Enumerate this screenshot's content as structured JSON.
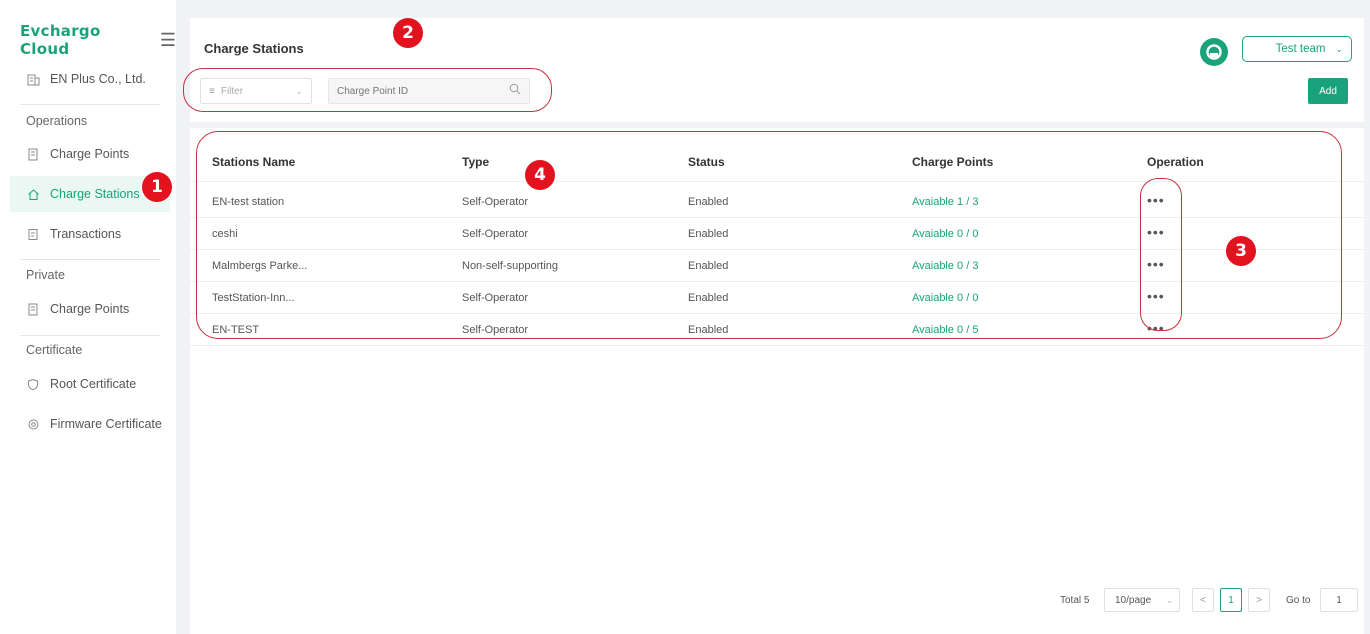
{
  "brand": {
    "name": "Evchargo Cloud"
  },
  "sidebar": {
    "company": "EN Plus Co., Ltd.",
    "sections": [
      {
        "title": "Operations",
        "items": [
          {
            "label": "Charge Points",
            "icon": "charger-icon"
          },
          {
            "label": "Charge Stations",
            "icon": "home-icon",
            "active": true
          },
          {
            "label": "Transactions",
            "icon": "receipt-icon"
          }
        ]
      },
      {
        "title": "Private",
        "items": [
          {
            "label": "Charge Points",
            "icon": "charger-icon"
          }
        ]
      },
      {
        "title": "Certificate",
        "items": [
          {
            "label": "Root Certificate",
            "icon": "shield-icon"
          },
          {
            "label": "Firmware Certificate",
            "icon": "gear-icon"
          }
        ]
      }
    ]
  },
  "header": {
    "title": "Charge Stations",
    "filter_placeholder": "Filter",
    "search_placeholder": "Charge Point ID",
    "team": "Test team",
    "add_label": "Add"
  },
  "table": {
    "columns": [
      "Stations Name",
      "Type",
      "Status",
      "Charge Points",
      "Operation"
    ],
    "rows": [
      {
        "name": "EN-test station",
        "type": "Self-Operator",
        "status": "Enabled",
        "charge_points": "Avaiable  1 / 3",
        "op": "•••"
      },
      {
        "name": "ceshi",
        "type": "Self-Operator",
        "status": "Enabled",
        "charge_points": "Avaiable  0 / 0",
        "op": "•••"
      },
      {
        "name": "Malmbergs Parke...",
        "type": "Non-self-supporting",
        "status": "Enabled",
        "charge_points": "Avaiable  0 / 3",
        "op": "•••"
      },
      {
        "name": "TestStation-Inn...",
        "type": "Self-Operator",
        "status": "Enabled",
        "charge_points": "Avaiable  0 / 0",
        "op": "•••"
      },
      {
        "name": "EN-TEST",
        "type": "Self-Operator",
        "status": "Enabled",
        "charge_points": "Avaiable  0 / 5",
        "op": "•••"
      }
    ]
  },
  "pagination": {
    "total": "Total 5",
    "page_size": "10/page",
    "prev": "<",
    "current": "1",
    "next": ">",
    "goto_label": "Go to",
    "goto_value": "1"
  },
  "annotations": [
    "1",
    "2",
    "3",
    "4"
  ],
  "colors": {
    "accent": "#1aa37a",
    "annotation": "#e2121e"
  }
}
